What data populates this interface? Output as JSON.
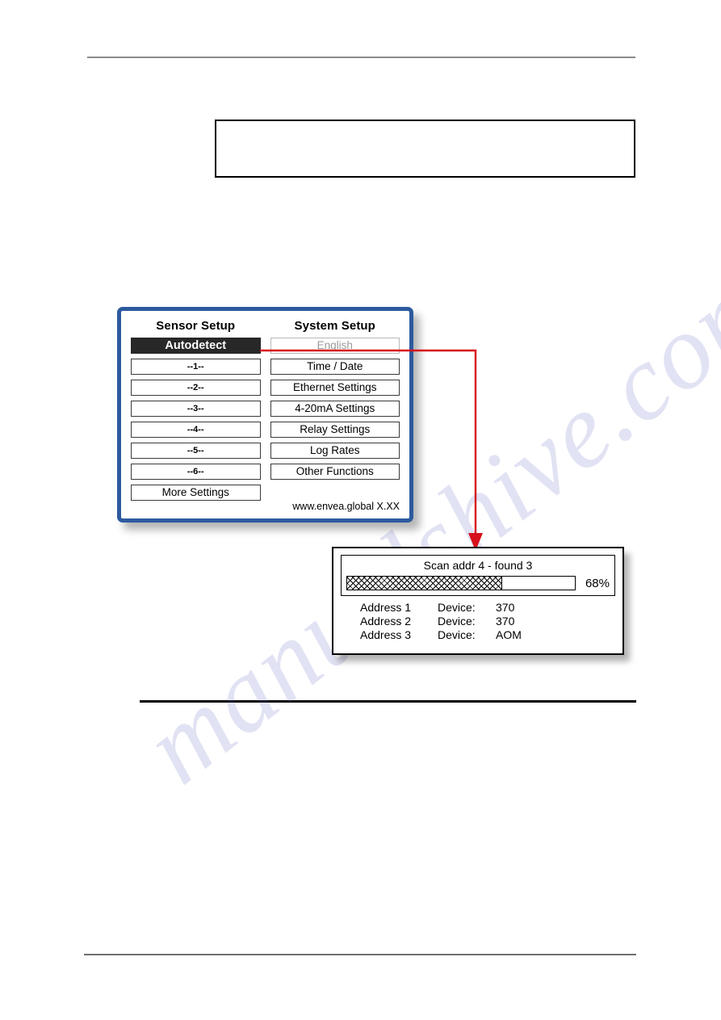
{
  "page": {
    "note_box": {
      "content": ""
    }
  },
  "device_screen": {
    "footer": "www.envea.global  X.XX",
    "columns": [
      {
        "heading": "Sensor Setup",
        "items": [
          {
            "label": "Autodetect",
            "state": "selected"
          },
          {
            "label": "--1--",
            "state": "normal"
          },
          {
            "label": "--2--",
            "state": "normal"
          },
          {
            "label": "--3--",
            "state": "normal"
          },
          {
            "label": "--4--",
            "state": "normal"
          },
          {
            "label": "--5--",
            "state": "normal"
          },
          {
            "label": "--6--",
            "state": "normal"
          },
          {
            "label": "More Settings",
            "state": "normal"
          }
        ]
      },
      {
        "heading": "System Setup",
        "items": [
          {
            "label": "English",
            "state": "disabled"
          },
          {
            "label": "Time / Date",
            "state": "normal"
          },
          {
            "label": "Ethernet Settings",
            "state": "normal"
          },
          {
            "label": "4-20mA Settings",
            "state": "normal"
          },
          {
            "label": "Relay Settings",
            "state": "normal"
          },
          {
            "label": "Log Rates",
            "state": "normal"
          },
          {
            "label": "Other Functions",
            "state": "normal"
          }
        ]
      }
    ]
  },
  "scan_dialog": {
    "title": "Scan addr 4 - found 3",
    "progress": {
      "percent": 68,
      "percent_label": "68%"
    },
    "rows": [
      {
        "address": "Address 1",
        "device_label": "Device:",
        "device": "370"
      },
      {
        "address": "Address 2",
        "device_label": "Device:",
        "device": "370"
      },
      {
        "address": "Address 3",
        "device_label": "Device:",
        "device": "AOM"
      }
    ]
  },
  "annotation": {
    "arrow_color": "#d6111b",
    "description": "Autodetect leads to scan dialog"
  },
  "watermark": {
    "text": "manualshive.com"
  },
  "colors": {
    "panel_border_blue": "#2c5a9e",
    "selected_background": "#282828",
    "arrow_red": "#d6111b"
  }
}
